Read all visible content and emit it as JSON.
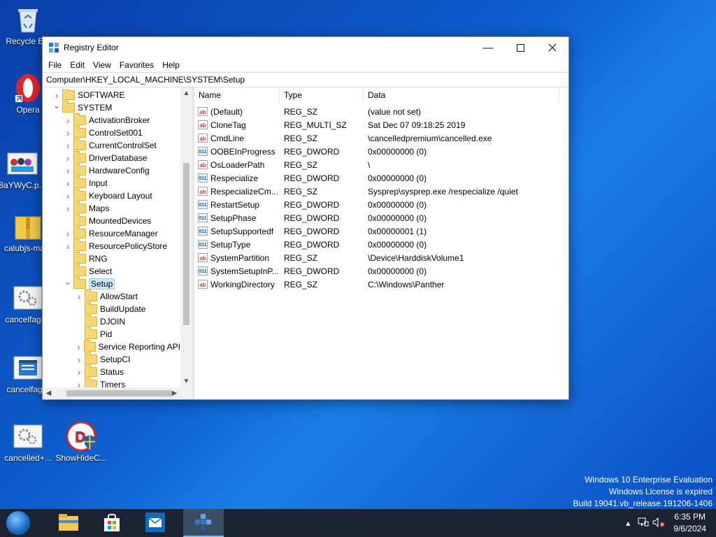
{
  "desktop": {
    "icons": [
      {
        "label": "Recycle Bin",
        "icon": "recycle-bin-icon"
      },
      {
        "label": "Opera",
        "icon": "opera-icon"
      },
      {
        "label": "8aYWyC.p...",
        "icon": "image-file-icon"
      },
      {
        "label": "calubjs-ma...",
        "icon": "zip-folder-icon"
      },
      {
        "label": "cancelfag-...",
        "icon": "settings-file-icon"
      },
      {
        "label": "cancelfag...",
        "icon": "window-file-icon"
      },
      {
        "label": "cancelled+...",
        "icon": "settings-file-icon"
      },
      {
        "label": "ShowHideC...",
        "icon": "app-shield-icon"
      }
    ],
    "watermark": {
      "line1": "Windows 10 Enterprise Evaluation",
      "line2": "Windows License is expired",
      "line3": "Build 19041.vb_release.191206-1406"
    }
  },
  "window": {
    "title": "Registry Editor",
    "menu": [
      "File",
      "Edit",
      "View",
      "Favorites",
      "Help"
    ],
    "address": "Computer\\HKEY_LOCAL_MACHINE\\SYSTEM\\Setup",
    "tree": [
      {
        "label": "SOFTWARE",
        "level": 1,
        "expander": "collapsed"
      },
      {
        "label": "SYSTEM",
        "level": 1,
        "expander": "expanded"
      },
      {
        "label": "ActivationBroker",
        "level": 2,
        "expander": "collapsed"
      },
      {
        "label": "ControlSet001",
        "level": 2,
        "expander": "collapsed"
      },
      {
        "label": "CurrentControlSet",
        "level": 2,
        "expander": "collapsed"
      },
      {
        "label": "DriverDatabase",
        "level": 2,
        "expander": "collapsed"
      },
      {
        "label": "HardwareConfig",
        "level": 2,
        "expander": "collapsed"
      },
      {
        "label": "Input",
        "level": 2,
        "expander": "collapsed"
      },
      {
        "label": "Keyboard Layout",
        "level": 2,
        "expander": "collapsed"
      },
      {
        "label": "Maps",
        "level": 2,
        "expander": "collapsed"
      },
      {
        "label": "MountedDevices",
        "level": 2,
        "expander": "none"
      },
      {
        "label": "ResourceManager",
        "level": 2,
        "expander": "collapsed"
      },
      {
        "label": "ResourcePolicyStore",
        "level": 2,
        "expander": "collapsed"
      },
      {
        "label": "RNG",
        "level": 2,
        "expander": "none"
      },
      {
        "label": "Select",
        "level": 2,
        "expander": "none"
      },
      {
        "label": "Setup",
        "level": 2,
        "expander": "expanded",
        "selected": true
      },
      {
        "label": "AllowStart",
        "level": 3,
        "expander": "collapsed"
      },
      {
        "label": "BuildUpdate",
        "level": 3,
        "expander": "none"
      },
      {
        "label": "DJOIN",
        "level": 3,
        "expander": "none"
      },
      {
        "label": "Pid",
        "level": 3,
        "expander": "none"
      },
      {
        "label": "Service Reporting API",
        "level": 3,
        "expander": "collapsed"
      },
      {
        "label": "SetupCI",
        "level": 3,
        "expander": "collapsed"
      },
      {
        "label": "Status",
        "level": 3,
        "expander": "collapsed"
      },
      {
        "label": "Timers",
        "level": 3,
        "expander": "collapsed"
      }
    ],
    "columns": {
      "name": "Name",
      "type": "Type",
      "data": "Data"
    },
    "values": [
      {
        "kind": "sz",
        "name": "(Default)",
        "type": "REG_SZ",
        "data": "(value not set)"
      },
      {
        "kind": "sz",
        "name": "CloneTag",
        "type": "REG_MULTI_SZ",
        "data": "Sat Dec 07 09:18:25 2019"
      },
      {
        "kind": "sz",
        "name": "CmdLine",
        "type": "REG_SZ",
        "data": "\\cancelledpremium\\cancelled.exe"
      },
      {
        "kind": "bin",
        "name": "OOBEInProgress",
        "type": "REG_DWORD",
        "data": "0x00000000 (0)"
      },
      {
        "kind": "sz",
        "name": "OsLoaderPath",
        "type": "REG_SZ",
        "data": "\\"
      },
      {
        "kind": "bin",
        "name": "Respecialize",
        "type": "REG_DWORD",
        "data": "0x00000000 (0)"
      },
      {
        "kind": "sz",
        "name": "RespecializeCm...",
        "type": "REG_SZ",
        "data": "Sysprep\\sysprep.exe /respecialize /quiet"
      },
      {
        "kind": "bin",
        "name": "RestartSetup",
        "type": "REG_DWORD",
        "data": "0x00000000 (0)"
      },
      {
        "kind": "bin",
        "name": "SetupPhase",
        "type": "REG_DWORD",
        "data": "0x00000000 (0)"
      },
      {
        "kind": "bin",
        "name": "SetupSupportedf",
        "type": "REG_DWORD",
        "data": "0x00000001 (1)"
      },
      {
        "kind": "bin",
        "name": "SetupType",
        "type": "REG_DWORD",
        "data": "0x00000000 (0)"
      },
      {
        "kind": "sz",
        "name": "SystemPartition",
        "type": "REG_SZ",
        "data": "\\Device\\HarddiskVolume1"
      },
      {
        "kind": "bin",
        "name": "SystemSetupInP...",
        "type": "REG_DWORD",
        "data": "0x00000000 (0)"
      },
      {
        "kind": "sz",
        "name": "WorkingDirectory",
        "type": "REG_SZ",
        "data": "C:\\Windows\\Panther"
      }
    ],
    "icons": {
      "sz": "ab",
      "bin": "011"
    }
  },
  "taskbar": {
    "apps": [
      {
        "name": "file-explorer-icon"
      },
      {
        "name": "store-icon"
      },
      {
        "name": "mail-icon"
      },
      {
        "name": "registry-editor-icon",
        "active": true
      }
    ],
    "clock": {
      "time": "6:35 PM",
      "date": "9/6/2024"
    }
  }
}
